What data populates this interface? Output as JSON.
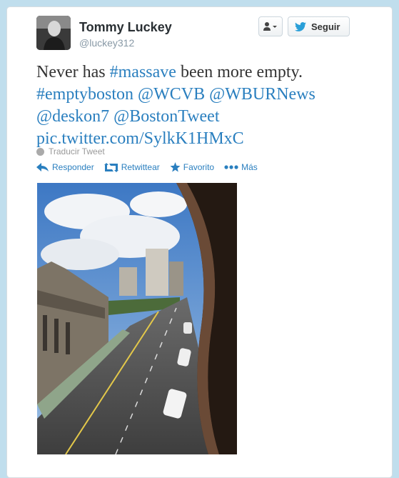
{
  "user": {
    "display_name": "Tommy Luckey",
    "screen_name": "@luckey312"
  },
  "header": {
    "follow_label": "Seguir",
    "user_dropdown_icon": "person-icon"
  },
  "tweet": {
    "lines": [
      {
        "plain": "Never has ",
        "hashtag": "#massave",
        "rest": " been more empty."
      },
      {
        "hashtag": "#emptyboston",
        "mention1": "@WCVB",
        "mention2": "@WBURNews"
      },
      {
        "mention1": "@deskon7",
        "mention2": "@BostonTweet"
      },
      {
        "link": "pic.twitter.com/SylkK1HMxC"
      }
    ]
  },
  "translate_label": "Traducir Tweet",
  "actions": {
    "reply": "Responder",
    "retweet": "Retwittear",
    "favorite": "Favorito",
    "more": "Más"
  },
  "colors": {
    "link": "#2a7fbf",
    "background": "#c0deed"
  }
}
